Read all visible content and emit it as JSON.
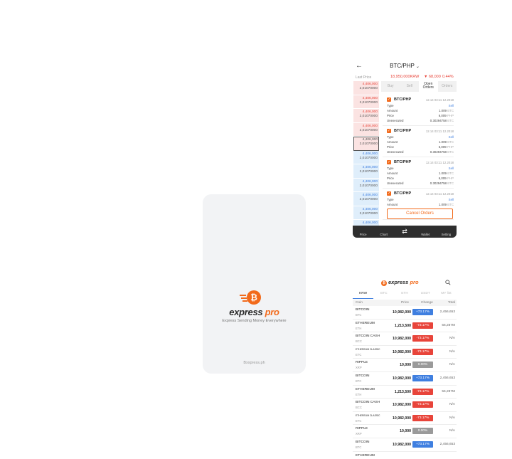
{
  "splash": {
    "brand_main": "express",
    "brand_accent": " pro",
    "tagline": "Express Sending Money Everywhere",
    "url": "Bxxpress.ph"
  },
  "order_screen": {
    "back_icon": "arrow-left-icon",
    "pair": "BTC/PHP",
    "last_price_label": "Last Price",
    "last_price": "18,950,000KRW",
    "change_value": "▼ 68,000",
    "change_pct": "0.44%",
    "order_book": [
      {
        "price": "4,406,000",
        "amount": "2,01070000",
        "side": "ask"
      },
      {
        "price": "4,406,000",
        "amount": "2,01070000",
        "side": "ask"
      },
      {
        "price": "4,406,000",
        "amount": "2,01070000",
        "side": "ask"
      },
      {
        "price": "4,406,000",
        "amount": "2,01070000",
        "side": "ask"
      },
      {
        "price": "4,406,000",
        "amount": "2,01070000",
        "side": "cur"
      },
      {
        "price": "4,406,000",
        "amount": "2,01070000",
        "side": "bid"
      },
      {
        "price": "4,406,000",
        "amount": "2,01070000",
        "side": "bid"
      },
      {
        "price": "4,406,000",
        "amount": "2,01070000",
        "side": "bid"
      },
      {
        "price": "4,406,000",
        "amount": "2,01070000",
        "side": "bid"
      },
      {
        "price": "4,406,000",
        "amount": "2,01070000",
        "side": "bid"
      },
      {
        "price": "4,406,000",
        "amount": "",
        "side": "bid"
      }
    ],
    "tabs": [
      "Buy",
      "Sell",
      "Open Orders",
      "Orders"
    ],
    "active_tab": "Open Orders",
    "orders": [
      {
        "pair": "BTC/PHP",
        "date": "12.14 03:11 12.2018",
        "type": "Sell",
        "amount": "1.009",
        "amount_unit": "BTC",
        "price": "6,009",
        "price_unit": "PHP",
        "unexecuted": "0.30294758",
        "unexecuted_unit": "BTC"
      },
      {
        "pair": "BTC/PHP",
        "date": "12.14 03:11 12.2018",
        "type": "Sell",
        "amount": "1.009",
        "amount_unit": "BTC",
        "price": "6,009",
        "price_unit": "PHP",
        "unexecuted": "0.30294758",
        "unexecuted_unit": "BTC"
      },
      {
        "pair": "BTC/PHP",
        "date": "12.14 03:11 12.2018",
        "type": "Sell",
        "amount": "1.009",
        "amount_unit": "BTC",
        "price": "6,009",
        "price_unit": "PHP",
        "unexecuted": "0.30294758",
        "unexecuted_unit": "BTC"
      },
      {
        "pair": "BTC/PHP",
        "date": "12.14 03:11 12.2018",
        "type": "Sell",
        "amount": "1.009",
        "amount_unit": "BTC"
      }
    ],
    "labels": {
      "type": "Type",
      "amount": "Amount",
      "price": "Price",
      "unexecuted": "Unexecuted"
    },
    "cancel_label": "Cancel Orders",
    "nav": [
      "Price",
      "Chart",
      "",
      "Wallet",
      "Setting"
    ]
  },
  "market": {
    "logo_main": "express",
    "logo_accent": " pro",
    "tabs": [
      "KRW",
      "BTC",
      "ETH",
      "USDT",
      "MY list"
    ],
    "active_tab": "KRW",
    "headers": {
      "coin": "Coin",
      "price": "Price",
      "change": "Change",
      "total": "Total"
    },
    "rows": [
      {
        "name": "BITCOIN",
        "sym": "BTC",
        "price": "10,982,000",
        "change": "+73.17%",
        "dir": "up",
        "total": "2,456,653"
      },
      {
        "name": "ETHEREUM",
        "sym": "ETH",
        "price": "1,213,500",
        "change": "-73.17%",
        "dir": "down",
        "total": "56,287M"
      },
      {
        "name": "BITCOIN CASH",
        "sym": "BCC",
        "price": "10,982,000",
        "change": "-73.17%",
        "dir": "down",
        "total": "N/A"
      },
      {
        "name": "ETHEREUM CLASSIC",
        "sym": "ETC",
        "price": "10,982,000",
        "change": "-73.17%",
        "dir": "down",
        "total": "N/A",
        "small": true
      },
      {
        "name": "RIPPLE",
        "sym": "XRP",
        "price": "10,000",
        "change": "0.00%",
        "dir": "flat",
        "total": "N/A"
      },
      {
        "name": "BITCOIN",
        "sym": "BTC",
        "price": "10,982,000",
        "change": "+73.17%",
        "dir": "up",
        "total": "2,456,653"
      },
      {
        "name": "ETHEREUM",
        "sym": "ETH",
        "price": "1,213,500",
        "change": "-73.17%",
        "dir": "down",
        "total": "56,287M"
      },
      {
        "name": "BITCOIN CASH",
        "sym": "BCC",
        "price": "10,982,000",
        "change": "-73.17%",
        "dir": "down",
        "total": "N/A"
      },
      {
        "name": "ETHEREUM CLASSIC",
        "sym": "ETC",
        "price": "10,982,000",
        "change": "-73.17%",
        "dir": "down",
        "total": "N/A",
        "small": true
      },
      {
        "name": "RIPPLE",
        "sym": "XRP",
        "price": "10,000",
        "change": "0.00%",
        "dir": "flat",
        "total": "N/A"
      },
      {
        "name": "BITCOIN",
        "sym": "BTC",
        "price": "10,982,000",
        "change": "+73.17%",
        "dir": "up",
        "total": "2,456,653"
      },
      {
        "name": "ETHEREUM",
        "sym": "",
        "price": "",
        "change": "",
        "dir": "down",
        "total": ""
      }
    ]
  },
  "colors": {
    "accent": "#f26a1b",
    "up": "#3f7fe0",
    "down": "#e8443a",
    "nav_bg": "#2e2e2e"
  }
}
